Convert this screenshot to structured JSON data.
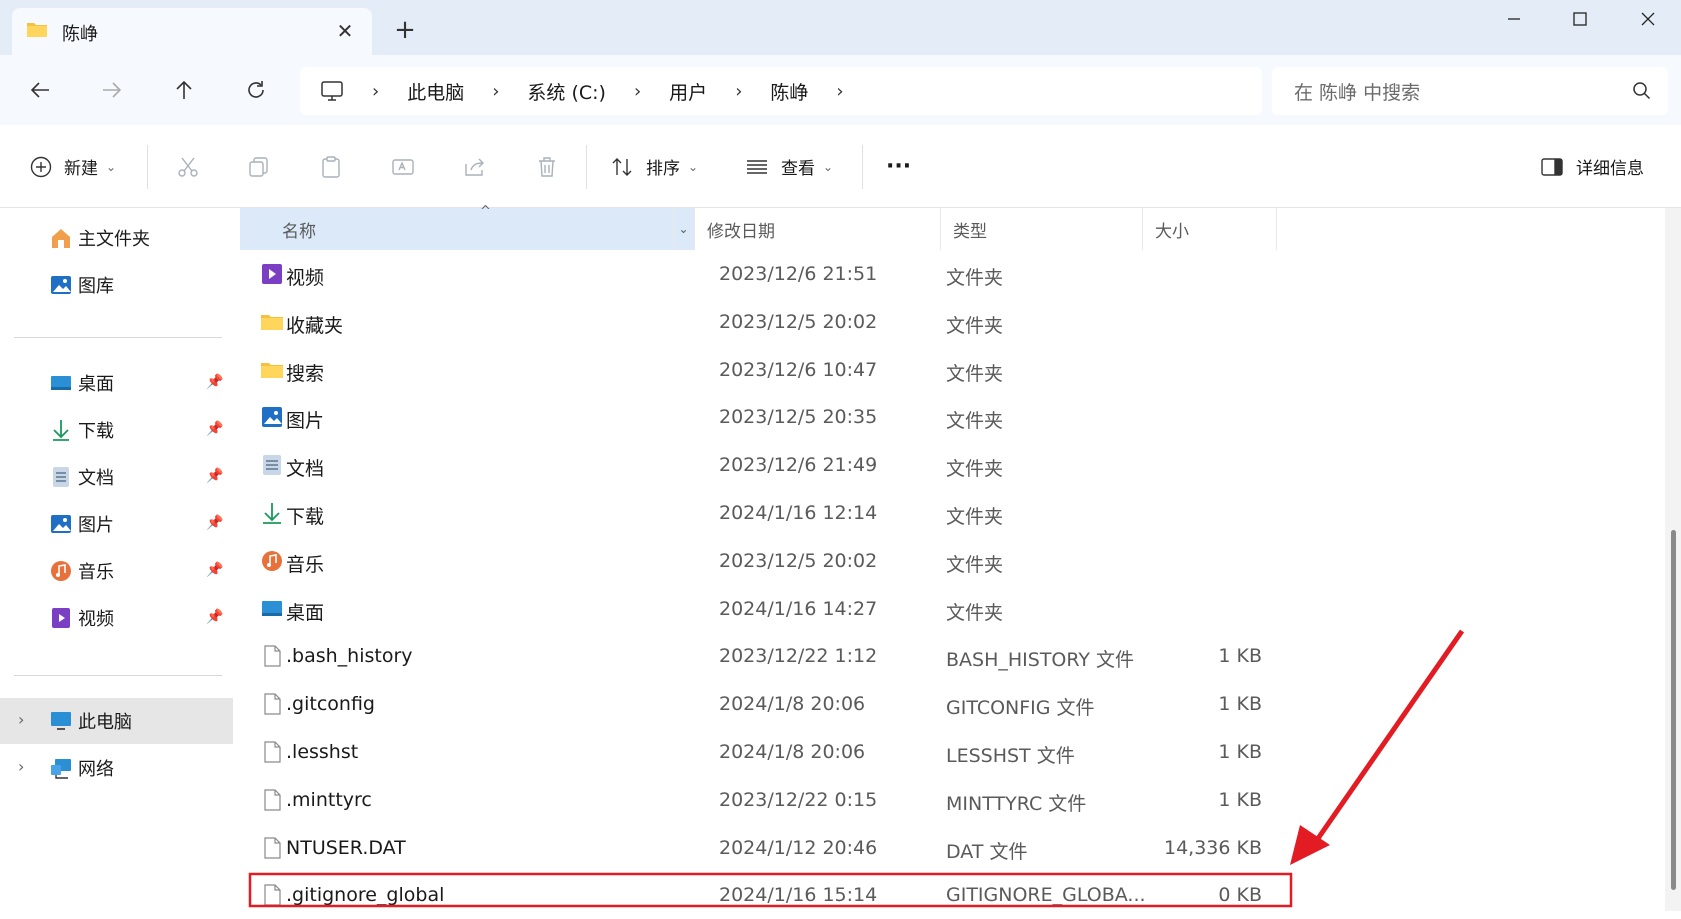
{
  "tab": {
    "title": "陈峥",
    "close": "✕",
    "new": "+"
  },
  "window": {
    "minimize": "—",
    "maximize": "☐",
    "close": "✕"
  },
  "breadcrumb": [
    "此电脑",
    "系统 (C:)",
    "用户",
    "陈峥"
  ],
  "search": {
    "placeholder": "在 陈峥 中搜索"
  },
  "toolbar": {
    "new_label": "新建",
    "sort_label": "排序",
    "view_label": "查看",
    "more": "···",
    "details_label": "详细信息"
  },
  "navpane": {
    "quick": [
      {
        "label": "主文件夹",
        "icon": "home-icon"
      },
      {
        "label": "图库",
        "icon": "gallery-icon"
      }
    ],
    "pinned": [
      {
        "label": "桌面",
        "icon": "desktop-icon"
      },
      {
        "label": "下载",
        "icon": "download-icon"
      },
      {
        "label": "文档",
        "icon": "document-icon"
      },
      {
        "label": "图片",
        "icon": "pictures-icon"
      },
      {
        "label": "音乐",
        "icon": "music-icon"
      },
      {
        "label": "视频",
        "icon": "video-icon"
      }
    ],
    "tree": [
      {
        "label": "此电脑",
        "icon": "computer-icon"
      },
      {
        "label": "网络",
        "icon": "network-icon"
      }
    ]
  },
  "columns": {
    "name": "名称",
    "date": "修改日期",
    "type": "类型",
    "size": "大小"
  },
  "files": [
    {
      "name": "视频",
      "date": "2023/12/6 21:51",
      "type": "文件夹",
      "size": "",
      "icon": "video-folder-icon"
    },
    {
      "name": "收藏夹",
      "date": "2023/12/5 20:02",
      "type": "文件夹",
      "size": "",
      "icon": "folder-icon"
    },
    {
      "name": "搜索",
      "date": "2023/12/6 10:47",
      "type": "文件夹",
      "size": "",
      "icon": "folder-icon"
    },
    {
      "name": "图片",
      "date": "2023/12/5 20:35",
      "type": "文件夹",
      "size": "",
      "icon": "pictures-folder-icon"
    },
    {
      "name": "文档",
      "date": "2023/12/6 21:49",
      "type": "文件夹",
      "size": "",
      "icon": "document-folder-icon"
    },
    {
      "name": "下载",
      "date": "2024/1/16 12:14",
      "type": "文件夹",
      "size": "",
      "icon": "download-folder-icon"
    },
    {
      "name": "音乐",
      "date": "2023/12/5 20:02",
      "type": "文件夹",
      "size": "",
      "icon": "music-folder-icon"
    },
    {
      "name": "桌面",
      "date": "2024/1/16 14:27",
      "type": "文件夹",
      "size": "",
      "icon": "desktop-folder-icon"
    },
    {
      "name": ".bash_history",
      "date": "2023/12/22 1:12",
      "type": "BASH_HISTORY 文件",
      "size": "1 KB",
      "icon": "file-icon"
    },
    {
      "name": ".gitconfig",
      "date": "2024/1/8 20:06",
      "type": "GITCONFIG 文件",
      "size": "1 KB",
      "icon": "file-icon"
    },
    {
      "name": ".lesshst",
      "date": "2024/1/8 20:06",
      "type": "LESSHST 文件",
      "size": "1 KB",
      "icon": "file-icon"
    },
    {
      "name": ".minttyrc",
      "date": "2023/12/22 0:15",
      "type": "MINTTYRC 文件",
      "size": "1 KB",
      "icon": "file-icon"
    },
    {
      "name": "NTUSER.DAT",
      "date": "2024/1/12 20:46",
      "type": "DAT 文件",
      "size": "14,336 KB",
      "icon": "file-icon"
    },
    {
      "name": ".gitignore_global",
      "date": "2024/1/16 15:14",
      "type": "GITIGNORE_GLOBA...",
      "size": "0 KB",
      "icon": "file-icon",
      "highlighted": true
    }
  ],
  "colors": {
    "annotation": "#e31b23",
    "header_selected": "#dbe9f9",
    "title_bar": "#e3ecf7"
  }
}
